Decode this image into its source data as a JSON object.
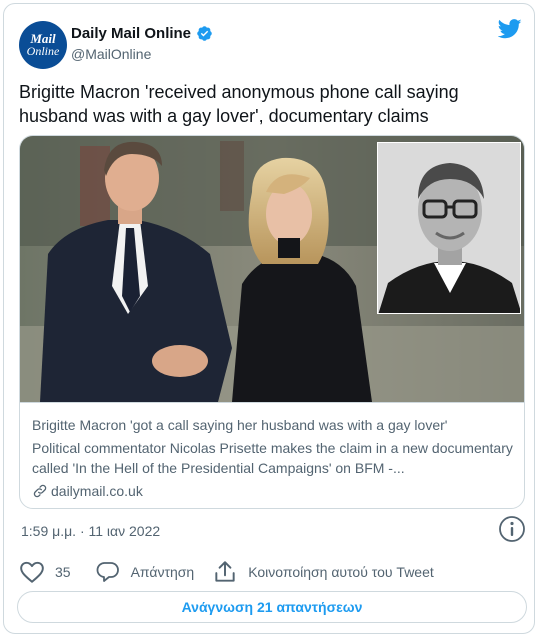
{
  "account": {
    "avatar_line1": "Mail",
    "avatar_line2": "Online",
    "display_name": "Daily Mail Online",
    "handle": "@MailOnline",
    "verified": true
  },
  "tweet": {
    "text": "Brigitte Macron 'received anonymous phone call saying husband was with a gay lover', documentary claims",
    "timestamp": "1:59 μ.μ. · 11 ιαν 2022"
  },
  "card": {
    "title": "Brigitte Macron 'got a call saying her husband was with a gay lover'",
    "description": "Political commentator Nicolas Prisette makes the claim in a new documentary called 'In the Hell of the Presidential Campaigns' on BFM -...",
    "domain": "dailymail.co.uk"
  },
  "actions": {
    "like_count": "35",
    "reply_label": "Απάντηση",
    "share_label": "Κοινοποίηση αυτού του Tweet"
  },
  "read_replies_label": "Ανάγνωση 21 απαντήσεων",
  "colors": {
    "twitter_blue": "#1d9bf0",
    "mail_blue": "#0a4d96",
    "secondary_text": "#536471",
    "border": "#cfd9de"
  },
  "icons": [
    "twitter-bird-icon",
    "verified-badge-icon",
    "link-icon",
    "info-icon",
    "heart-icon",
    "reply-icon",
    "share-icon"
  ]
}
